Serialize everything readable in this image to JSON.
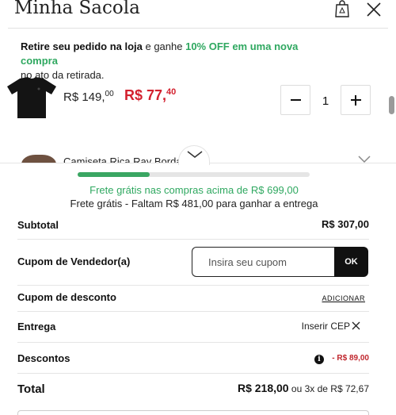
{
  "header": {
    "title": "Minha Sacola"
  },
  "pickup_banner": {
    "bold_text": "Retire seu pedido na loja",
    "middle_text": " e ganhe ",
    "highlight_text": "10% OFF em uma nova compra",
    "end_text": "no ato da retirada."
  },
  "cart": {
    "items": [
      {
        "price_old_main": "R$ 149,",
        "price_old_cents": "00",
        "price_new_main": "R$ 77,",
        "price_new_cents": "40",
        "quantity": "1"
      },
      {
        "name": "Camiseta Rica Ray Bordado C"
      }
    ]
  },
  "shipping": {
    "progress": 0.31,
    "free_shipping_text": "Frete grátis nas compras acima de R$ 699,00",
    "remaining_text": "Frete grátis - Faltam R$ 481,00 para ganhar a entrega"
  },
  "summary": {
    "subtotal_label": "Subtotal",
    "subtotal_value": "R$ 307,00",
    "seller_coupon_label": "Cupom de Vendedor(a)",
    "coupon_placeholder": "Insira seu cupom",
    "coupon_button": "OK",
    "discount_coupon_label": "Cupom de desconto",
    "discount_coupon_action": "ADICIONAR",
    "delivery_label": "Entrega",
    "delivery_action": "Inserir CEP",
    "discounts_label": "Descontos",
    "discounts_value": "- R$ 89,00",
    "total_label": "Total",
    "total_value": "R$ 218,00",
    "installments_text": " ou 3x de R$ 72,67"
  },
  "colors": {
    "accent_green": "#2fa860",
    "price_red": "#d3202e"
  }
}
